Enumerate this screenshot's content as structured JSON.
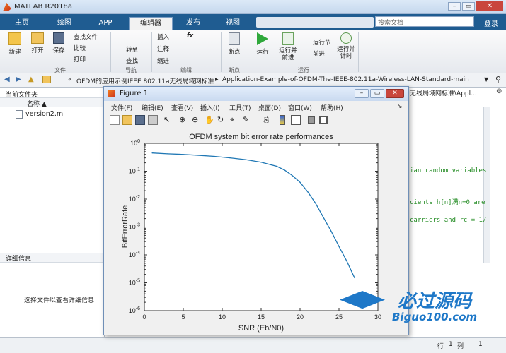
{
  "window": {
    "title": "MATLAB R2018a",
    "search_placeholder": "搜索文档",
    "login": "登录"
  },
  "tabs": [
    "主页",
    "绘图",
    "APP",
    "编辑器",
    "发布",
    "视图"
  ],
  "ribbon": {
    "file": [
      "新建",
      "打开",
      "保存"
    ],
    "find_files": "查找文件",
    "compare": "比较",
    "print": "打印",
    "file_section": "文件",
    "goto": "转至",
    "find": "查找",
    "nav_section": "导航",
    "insert": "插入",
    "fx": "fx",
    "comment": "注释",
    "indent": "缩进",
    "edit_section": "编辑",
    "breakpoints": "断点",
    "bp_section": "断点",
    "run": "运行",
    "run_advance": "运行并前进",
    "run_section": "运行节",
    "advance": "前进",
    "run_time": "运行并计时",
    "run_group": "运行"
  },
  "address": {
    "path": [
      "«",
      "OFDM的应用示例IEEE 802.11a无线局域网标准",
      "▸",
      "Application-Example-of-OFDM-The-IEEE-802.11a-Wireless-LAN-Standard-main"
    ]
  },
  "current_folder": {
    "title": "当前文件夹",
    "column": "名称 ▲",
    "files": [
      "version2.m"
    ]
  },
  "details": {
    "title": "详细信息",
    "hint": "选择文件以查看详细信息"
  },
  "editor": {
    "path_tail": "无线局域网标准\\Appl...",
    "lines": [
      "ian random variables",
      "cients h[n]满n=0 are",
      "carriers and rc = 1/"
    ]
  },
  "status": {
    "row_label": "行",
    "row": "1",
    "col_label": "列",
    "col": "1"
  },
  "figure": {
    "title": "Figure 1",
    "menus": [
      "文件(F)",
      "编辑(E)",
      "查看(V)",
      "插入(I)",
      "工具(T)",
      "桌面(D)",
      "窗口(W)",
      "帮助(H)"
    ]
  },
  "chart_data": {
    "type": "line",
    "title": "OFDM system bit error rate performances",
    "xlabel": "SNR (Eb/N0)",
    "ylabel": "BitErrorRate",
    "xlim": [
      0,
      30
    ],
    "ylim": [
      1e-06,
      1
    ],
    "yscale": "log",
    "x_ticks": [
      "0",
      "5",
      "10",
      "15",
      "20",
      "25",
      "30"
    ],
    "y_ticks": [
      "10^0",
      "10^-1",
      "10^-2",
      "10^-3",
      "10^-4",
      "10^-5",
      "10^-6"
    ],
    "series": [
      {
        "color": "#1f77b4",
        "x": [
          1,
          3,
          5,
          7,
          9,
          11,
          13,
          15,
          17,
          18,
          19,
          20,
          21,
          22,
          23,
          24,
          25,
          26,
          27
        ],
        "y": [
          0.45,
          0.42,
          0.4,
          0.37,
          0.34,
          0.3,
          0.26,
          0.21,
          0.15,
          0.11,
          0.07,
          0.04,
          0.018,
          0.007,
          0.0022,
          0.0007,
          0.0002,
          6e-05,
          1.5e-05
        ]
      }
    ]
  },
  "watermark": {
    "name": "必过源码",
    "url": "Biguo100.com"
  }
}
